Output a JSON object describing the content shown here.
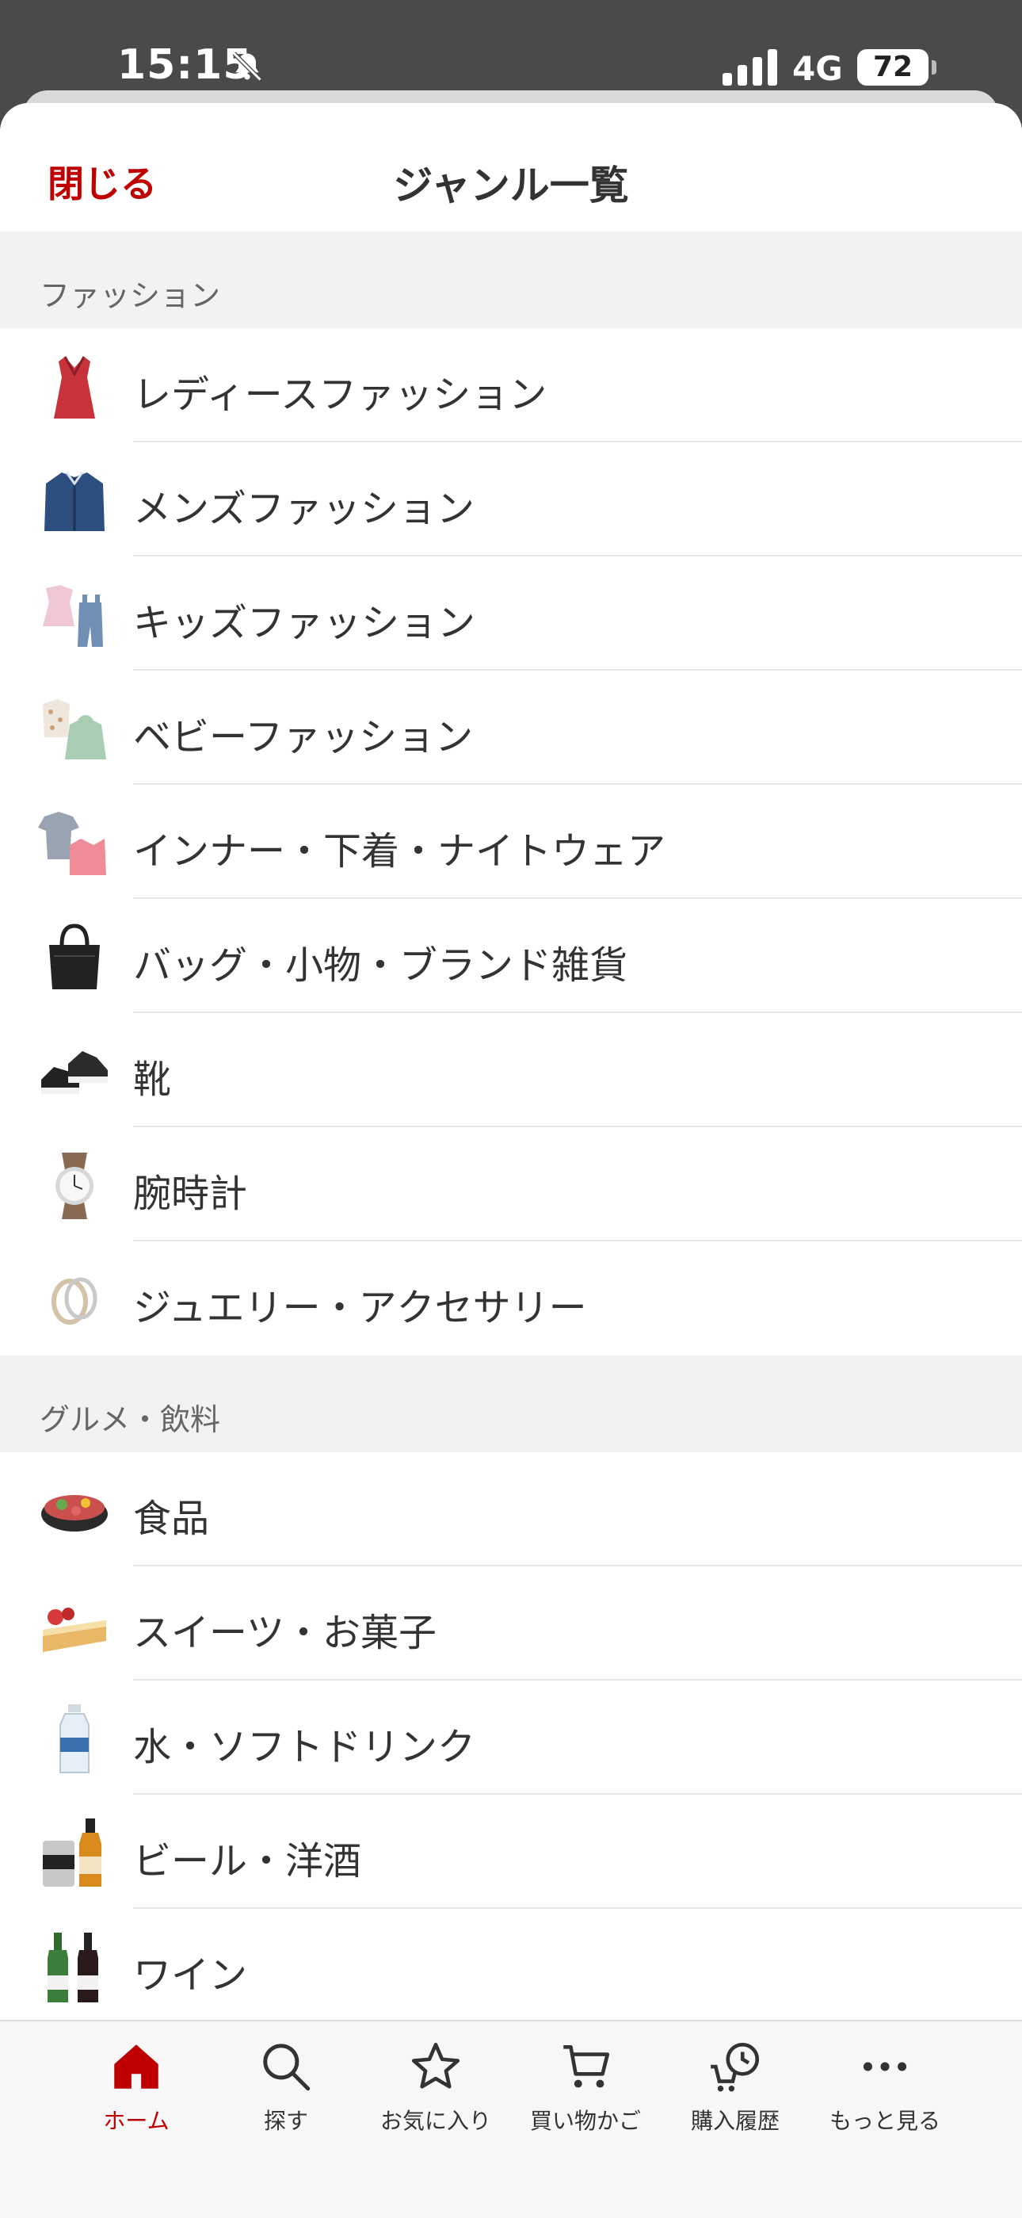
{
  "status_bar": {
    "time": "15:15",
    "network": "4G",
    "battery": "72"
  },
  "header": {
    "close_label": "閉じる",
    "title": "ジャンル一覧"
  },
  "sections": [
    {
      "title": "ファッション",
      "items": [
        {
          "label": "レディースファッション",
          "icon": "dress-icon"
        },
        {
          "label": "メンズファッション",
          "icon": "shirt-icon"
        },
        {
          "label": "キッズファッション",
          "icon": "kids-clothes-icon"
        },
        {
          "label": "ベビーファッション",
          "icon": "baby-clothes-icon"
        },
        {
          "label": "インナー・下着・ナイトウェア",
          "icon": "innerwear-icon"
        },
        {
          "label": "バッグ・小物・ブランド雑貨",
          "icon": "bag-icon"
        },
        {
          "label": "靴",
          "icon": "sneakers-icon"
        },
        {
          "label": "腕時計",
          "icon": "watch-icon"
        },
        {
          "label": "ジュエリー・アクセサリー",
          "icon": "rings-icon"
        }
      ]
    },
    {
      "title": "グルメ・飲料",
      "items": [
        {
          "label": "食品",
          "icon": "food-pot-icon"
        },
        {
          "label": "スイーツ・お菓子",
          "icon": "cake-icon"
        },
        {
          "label": "水・ソフトドリンク",
          "icon": "water-bottle-icon"
        },
        {
          "label": "ビール・洋酒",
          "icon": "beer-icon"
        },
        {
          "label": "ワイン",
          "icon": "wine-bottles-icon"
        }
      ]
    }
  ],
  "tab_bar": {
    "items": [
      {
        "label": "ホーム",
        "icon": "home-icon",
        "active": true
      },
      {
        "label": "探す",
        "icon": "search-icon",
        "active": false
      },
      {
        "label": "お気に入り",
        "icon": "star-icon",
        "active": false
      },
      {
        "label": "買い物かご",
        "icon": "cart-icon",
        "active": false
      },
      {
        "label": "購入履歴",
        "icon": "purchase-history-icon",
        "active": false
      },
      {
        "label": "もっと見る",
        "icon": "more-icon",
        "active": false
      }
    ]
  },
  "colors": {
    "accent": "#bf0000",
    "text": "#333333",
    "section_bg": "#f2f2f2",
    "status_bar_bg": "#4a4a4a"
  }
}
